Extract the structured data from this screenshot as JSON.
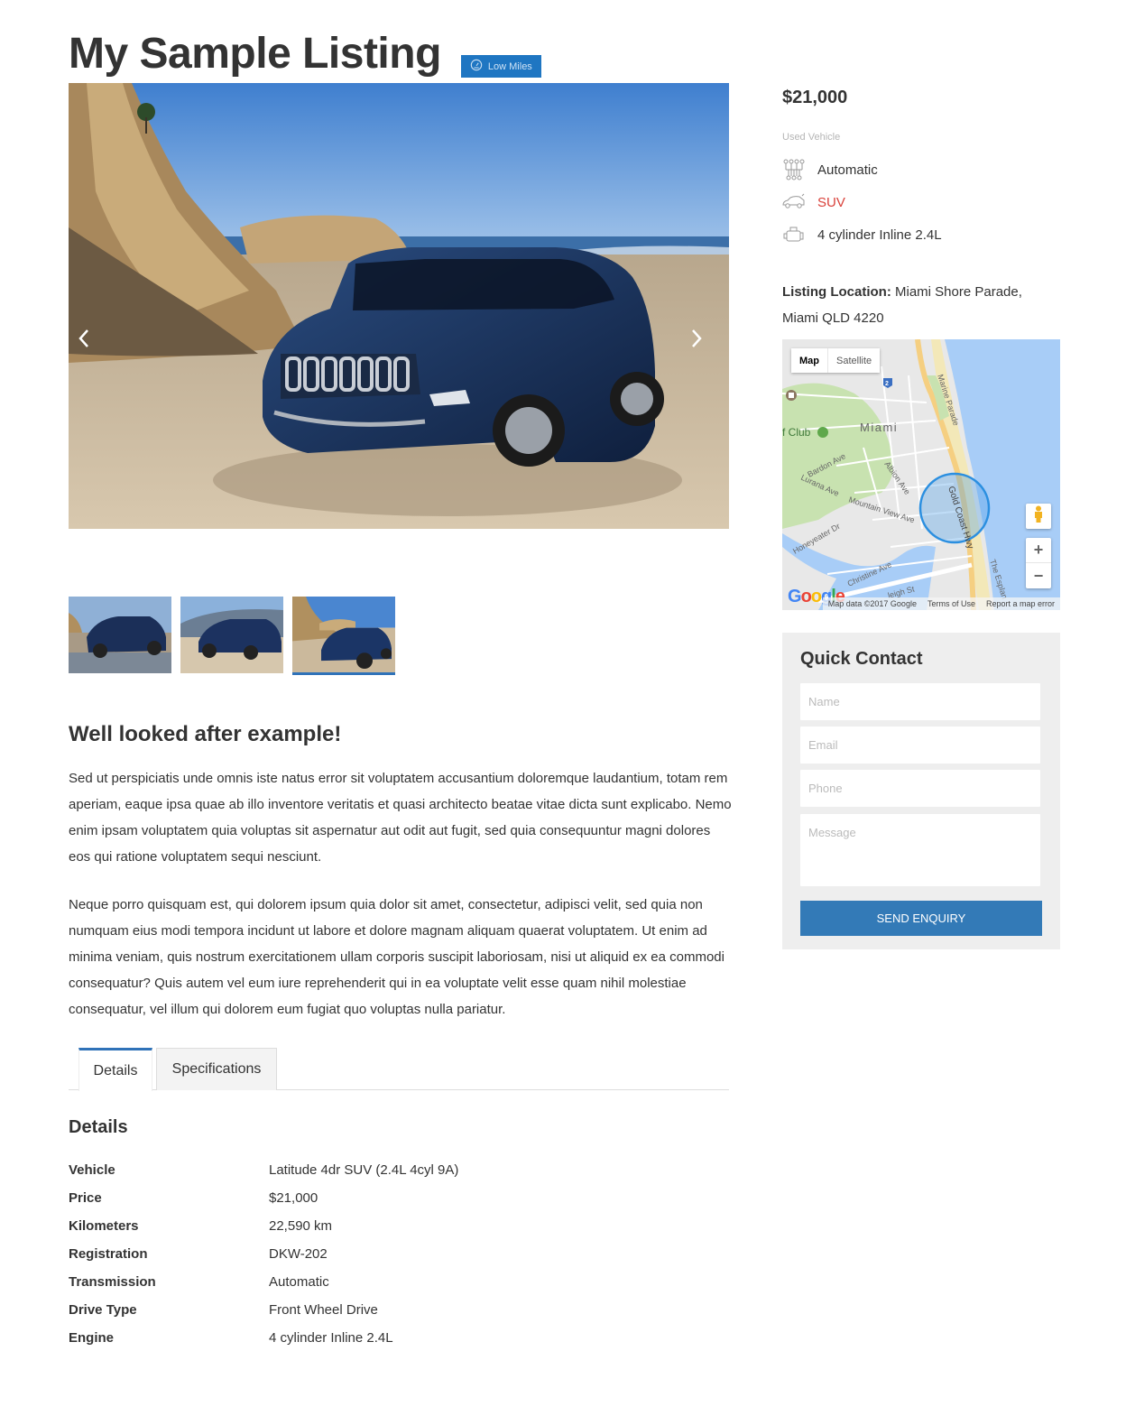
{
  "listing": {
    "title": "My Sample Listing",
    "badge": {
      "label": "Low Miles",
      "icon": "speedometer-icon",
      "color": "#1f76c2"
    }
  },
  "gallery": {
    "prev_icon": "chevron-left-icon",
    "next_icon": "chevron-right-icon",
    "thumbnails": [
      {
        "alt": "Blue SUV on wet beach",
        "active": false
      },
      {
        "alt": "Blue SUV rear view with mountains",
        "active": false
      },
      {
        "alt": "Blue SUV by cliffs on beach",
        "active": true
      }
    ],
    "accent_color": "#2f72b8"
  },
  "description": {
    "heading": "Well looked after example!",
    "paragraphs": [
      "Sed ut perspiciatis unde omnis iste natus error sit voluptatem accusantium doloremque laudantium, totam rem aperiam, eaque ipsa quae ab illo inventore veritatis et quasi architecto beatae vitae dicta sunt explicabo. Nemo enim ipsam voluptatem quia voluptas sit aspernatur aut odit aut fugit, sed quia consequuntur magni dolores eos qui ratione voluptatem sequi nesciunt.",
      "Neque porro quisquam est, qui dolorem ipsum quia dolor sit amet, consectetur, adipisci velit, sed quia non numquam eius modi tempora incidunt ut labore et dolore magnam aliquam quaerat voluptatem. Ut enim ad minima veniam, quis nostrum exercitationem ullam corporis suscipit laboriosam, nisi ut aliquid ex ea commodi consequatur? Quis autem vel eum iure reprehenderit qui in ea voluptate velit esse quam nihil molestiae consequatur, vel illum qui dolorem eum fugiat quo voluptas nulla pariatur."
    ]
  },
  "tabs": [
    {
      "label": "Details",
      "active": true
    },
    {
      "label": "Specifications",
      "active": false
    }
  ],
  "details": {
    "heading": "Details",
    "rows": [
      {
        "label": "Vehicle",
        "value": "Latitude 4dr SUV (2.4L 4cyl 9A)"
      },
      {
        "label": "Price",
        "value": "$21,000"
      },
      {
        "label": "Kilometers",
        "value": "22,590 km"
      },
      {
        "label": "Registration",
        "value": "DKW-202"
      },
      {
        "label": "Transmission",
        "value": "Automatic"
      },
      {
        "label": "Drive Type",
        "value": "Front Wheel Drive"
      },
      {
        "label": "Engine",
        "value": "4 cylinder Inline 2.4L"
      }
    ]
  },
  "sidebar": {
    "price": "$21,000",
    "condition": "Used Vehicle",
    "features": [
      {
        "icon": "gearshift-icon",
        "value": "Automatic"
      },
      {
        "icon": "car-body-icon",
        "value": "SUV",
        "color": "#d9413a"
      },
      {
        "icon": "engine-icon",
        "value": "4 cylinder Inline 2.4L"
      }
    ],
    "location": {
      "label": "Listing Location:",
      "address": "Miami Shore Parade, Miami QLD 4220"
    },
    "map": {
      "type_buttons": [
        "Map",
        "Satellite"
      ],
      "active_type": "Map",
      "labels": {
        "suburb": "Miami",
        "golf": "f Club",
        "roads": [
          "Marine Parade",
          "Gold Coast Hwy",
          "Bardon Ave",
          "Lurana Ave",
          "Albion Ave",
          "Mountain View Ave",
          "Honeyeater Dr",
          "Christine Ave",
          "The Esplan",
          "leigh St"
        ],
        "route_shield": "2"
      },
      "google_logo": "Google",
      "attribution": [
        "Map data ©2017 Google",
        "Terms of Use",
        "Report a map error"
      ],
      "zoom_in": "+",
      "zoom_out": "−"
    },
    "contact": {
      "title": "Quick Contact",
      "name_placeholder": "Name",
      "email_placeholder": "Email",
      "phone_placeholder": "Phone",
      "message_placeholder": "Message",
      "submit_label": "SEND ENQUIRY",
      "button_color": "#337ab7"
    }
  }
}
